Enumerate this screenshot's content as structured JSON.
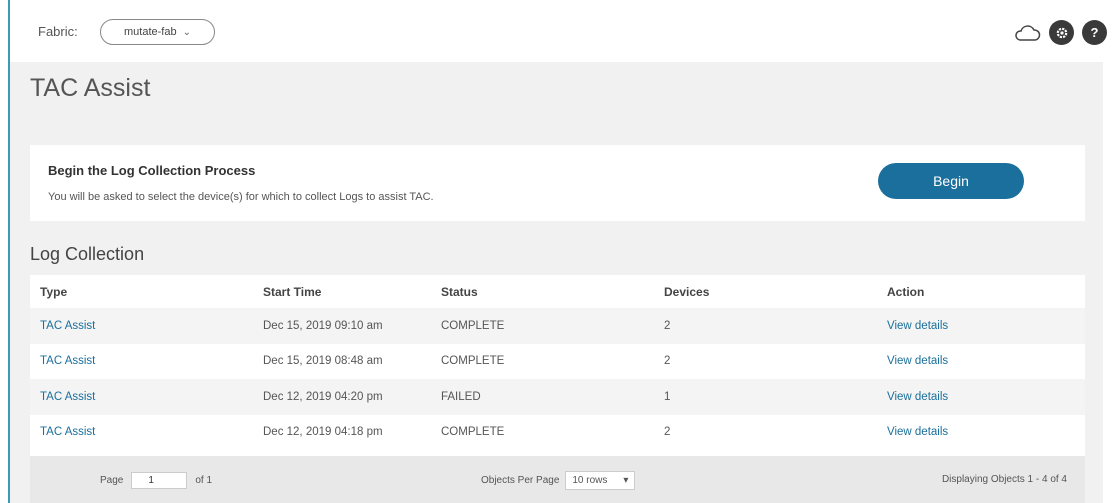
{
  "header": {
    "fabric_label": "Fabric:",
    "fabric_value": "mutate-fab",
    "help_glyph": "?"
  },
  "page": {
    "title": "TAC Assist"
  },
  "begin_card": {
    "title": "Begin the Log Collection Process",
    "description": "You will be asked to select the device(s) for which to collect Logs to assist TAC.",
    "button_label": "Begin"
  },
  "log_collection": {
    "title": "Log Collection",
    "columns": [
      "Type",
      "Start Time",
      "Status",
      "Devices",
      "Action"
    ],
    "rows": [
      {
        "type": "TAC Assist",
        "start_time": "Dec 15, 2019 09:10 am",
        "status": "COMPLETE",
        "devices": "2",
        "action": "View details"
      },
      {
        "type": "TAC Assist",
        "start_time": "Dec 15, 2019 08:48 am",
        "status": "COMPLETE",
        "devices": "2",
        "action": "View details"
      },
      {
        "type": "TAC Assist",
        "start_time": "Dec 12, 2019 04:20 pm",
        "status": "FAILED",
        "devices": "1",
        "action": "View details"
      },
      {
        "type": "TAC Assist",
        "start_time": "Dec 12, 2019 04:18 pm",
        "status": "COMPLETE",
        "devices": "2",
        "action": "View details"
      }
    ]
  },
  "pager": {
    "page_label": "Page",
    "page_value": "1",
    "of_label": "of 1",
    "per_page_label": "Objects Per Page",
    "rows_value": "10 rows",
    "display_text": "Displaying Objects 1 - 4 of 4"
  },
  "colors": {
    "accent": "#1a6f9c",
    "background": "#f1f1f1"
  }
}
